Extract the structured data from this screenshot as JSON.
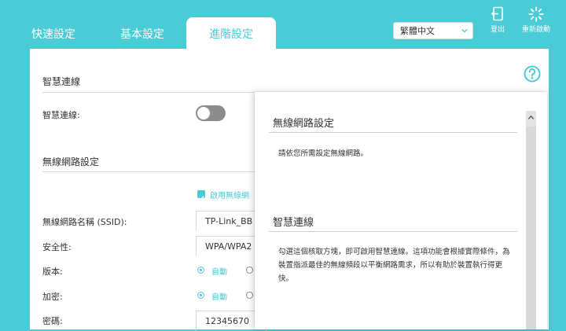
{
  "tabs": [
    {
      "label": "快速設定"
    },
    {
      "label": "基本設定"
    },
    {
      "label": "進階設定",
      "active": true
    }
  ],
  "language": {
    "selected": "繁體中文"
  },
  "top_buttons": {
    "logout": "登出",
    "reboot": "重新啟動"
  },
  "smart_connect": {
    "section_title": "智慧連線",
    "label": "智慧連線:",
    "enabled": false
  },
  "wireless": {
    "section_title": "無線網路設定",
    "enable_label": "啟用無線網",
    "ssid_label": "無線網路名稱 (SSID):",
    "ssid_value": "TP-Link_BB",
    "security_label": "安全性:",
    "security_value": "WPA/WPA2",
    "version_label": "版本:",
    "version_option": "自動",
    "encryption_label": "加密:",
    "encryption_option": "自動",
    "password_label": "密碼:",
    "password_value": "12345670"
  },
  "help": {
    "heading1": "無線網路設定",
    "text1": "請依您所需設定無線網路。",
    "heading2": "智慧連線",
    "text2": "勾選這個核取方塊，即可啟用智慧連線。這項功能會根據實際條件，為裝置指派最佳的無線頻段以平衡網路需求，所以有助於裝置執行得更快。"
  },
  "colors": {
    "accent": "#4acbd6",
    "toggle_off": "#8c8c8c"
  },
  "icons": [
    "logout-icon",
    "reboot-icon",
    "help-icon",
    "chevron-down-icon",
    "scroll-up-icon"
  ]
}
